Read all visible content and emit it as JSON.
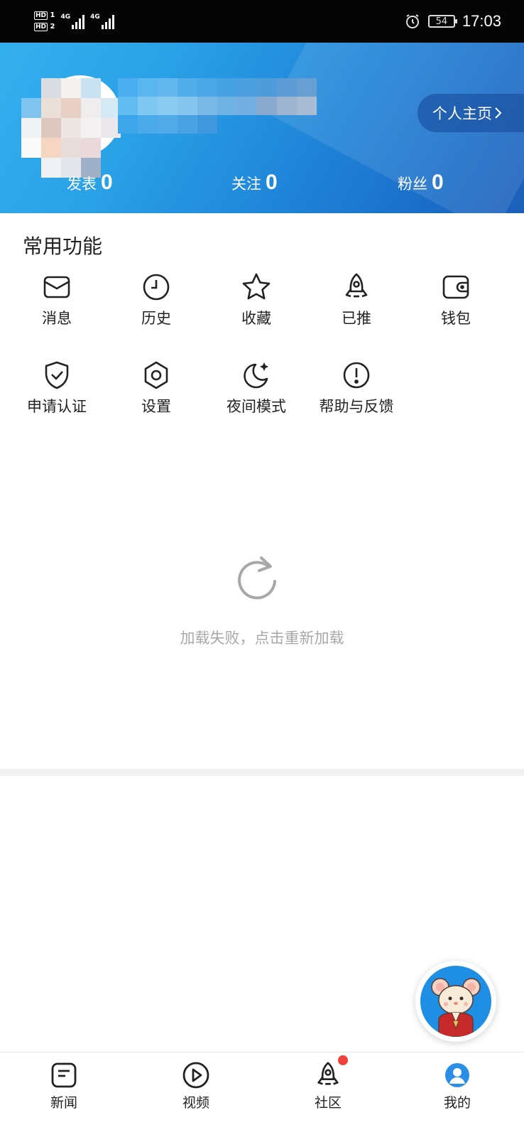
{
  "status_bar": {
    "hd1": "HD",
    "hd1_sub": "1",
    "hd2": "HD",
    "hd2_sub": "2",
    "net1": "4G",
    "net2": "4G",
    "battery": "54",
    "time": "17:03",
    "icons": [
      "alarm-clock-icon",
      "battery-icon",
      "signal-icon"
    ]
  },
  "header": {
    "profile_button": "个人主页",
    "stats": [
      {
        "label": "发表",
        "value": "0"
      },
      {
        "label": "关注",
        "value": "0"
      },
      {
        "label": "粉丝",
        "value": "0"
      }
    ]
  },
  "functions": {
    "title": "常用功能",
    "items": [
      {
        "label": "消息",
        "icon": "mail-icon"
      },
      {
        "label": "历史",
        "icon": "clock-icon"
      },
      {
        "label": "收藏",
        "icon": "star-icon"
      },
      {
        "label": "已推",
        "icon": "rocket-icon"
      },
      {
        "label": "钱包",
        "icon": "wallet-icon"
      },
      {
        "label": "申请认证",
        "icon": "shield-check-icon"
      },
      {
        "label": "设置",
        "icon": "settings-hexagon-icon"
      },
      {
        "label": "夜间模式",
        "icon": "moon-icon"
      },
      {
        "label": "帮助与反馈",
        "icon": "alert-circle-icon"
      }
    ]
  },
  "content": {
    "reload_text": "加载失败，点击重新加载"
  },
  "tabbar": {
    "tabs": [
      {
        "label": "新闻",
        "icon": "news-icon"
      },
      {
        "label": "视频",
        "icon": "play-circle-icon"
      },
      {
        "label": "社区",
        "icon": "rocket-icon"
      },
      {
        "label": "我的",
        "icon": "profile-icon"
      }
    ]
  },
  "colors": {
    "header_blue": "#2a96e2",
    "badge_red": "#f0403a",
    "muted_text": "#a8a8a8"
  }
}
